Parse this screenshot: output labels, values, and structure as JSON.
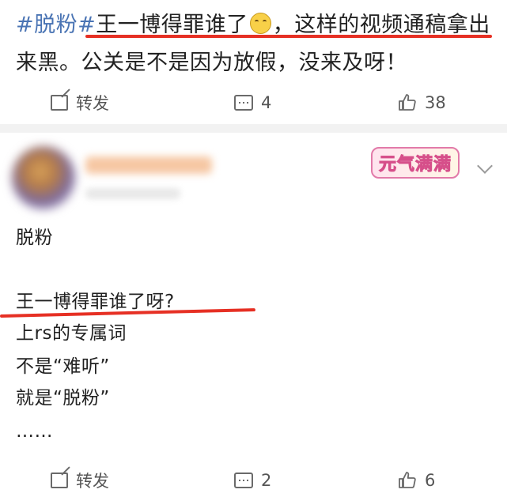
{
  "post1": {
    "hashtag": "#脱粉#",
    "text_before_emoji": "王一博得罪谁了",
    "emoji": "laughing-crying-emoji",
    "text_after_emoji": "，这样的视频通稿拿出来黑。公关是不是因为放假，没来及呀！",
    "actions": {
      "repost_label": "转发",
      "comment_count": "4",
      "like_count": "38"
    }
  },
  "post2": {
    "badge": "元气满满",
    "lines": [
      "脱粉",
      "王一博得罪谁了呀?",
      "上rs的专属词",
      "不是“难听”",
      "就是“脱粉”",
      "……"
    ],
    "actions": {
      "repost_label": "转发",
      "comment_count": "2",
      "like_count": "6"
    }
  },
  "colors": {
    "hashtag": "#4a74b4",
    "underline": "#e63024",
    "text": "#222222",
    "divider": "#f2f2f2"
  }
}
